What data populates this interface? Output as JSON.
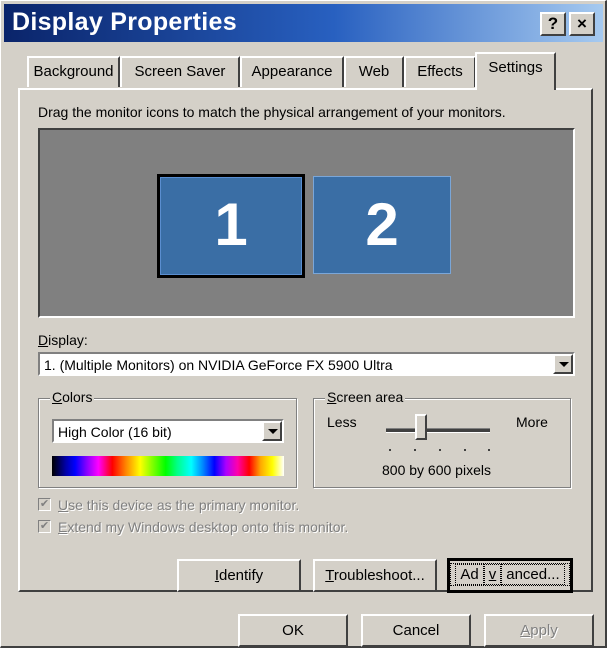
{
  "window": {
    "title": "Display Properties",
    "help_label": "?",
    "close_label": "×"
  },
  "tabs": [
    "Background",
    "Screen Saver",
    "Appearance",
    "Web",
    "Effects",
    "Settings"
  ],
  "active_tab": "Settings",
  "settings": {
    "instruction": "Drag the monitor icons to match the physical arrangement of your monitors.",
    "monitors": [
      "1",
      "2"
    ],
    "display_label_first": "D",
    "display_label_rest": "isplay:",
    "display_value": "1. (Multiple Monitors) on NVIDIA GeForce FX 5900 Ultra",
    "colors_group_first": "C",
    "colors_group_rest": "olors",
    "colors_value": "High Color (16 bit)",
    "screen_area_group_first": "S",
    "screen_area_group_rest": "creen area",
    "less_label": "Less",
    "more_label": "More",
    "resolution": "800 by 600 pixels",
    "checkbox_primary_first": "U",
    "checkbox_primary_rest": "se this device as the primary monitor.",
    "checkbox_extend_first": "E",
    "checkbox_extend_rest": "xtend my Windows desktop onto this monitor.",
    "identify_first": "I",
    "identify_rest": "dentify",
    "troubleshoot_first": "T",
    "troubleshoot_rest": "roubleshoot...",
    "advanced_pre": "Ad",
    "advanced_u": "v",
    "advanced_post": "anced..."
  },
  "footer": {
    "ok": "OK",
    "cancel": "Cancel",
    "apply_first": "A",
    "apply_rest": "pply"
  }
}
